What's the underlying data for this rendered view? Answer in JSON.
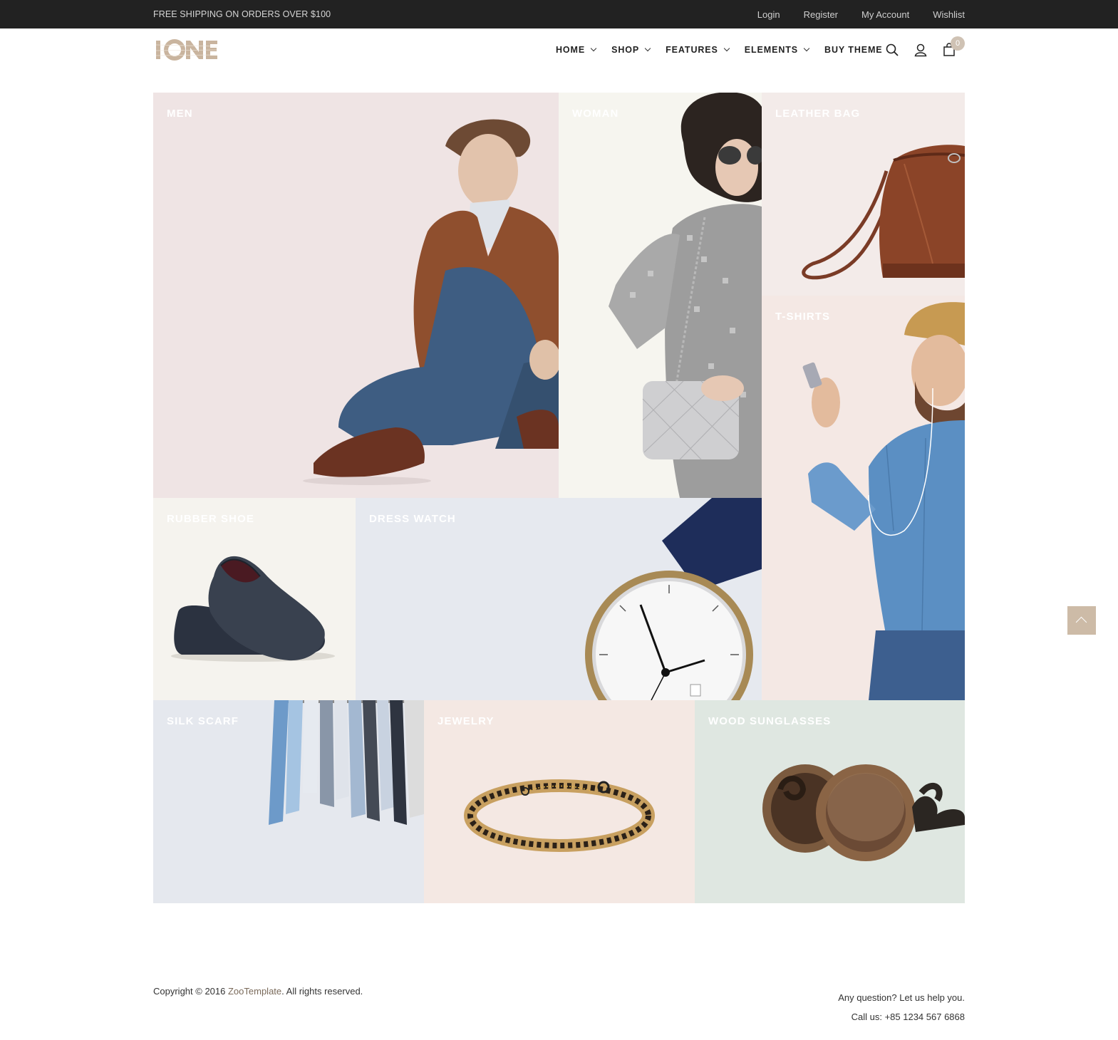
{
  "topbar": {
    "promo": "FREE SHIPPING ON ORDERS OVER $100",
    "links": [
      "Login",
      "Register",
      "My Account",
      "Wishlist"
    ]
  },
  "header": {
    "logo_text": "IONE",
    "nav": [
      "HOME",
      "SHOP",
      "FEATURES",
      "ELEMENTS",
      "BUY THEME"
    ],
    "cart_count": "0",
    "icons": [
      "search-icon",
      "user-icon",
      "cart-icon"
    ]
  },
  "tiles": {
    "men": "MEN",
    "woman": "WOMAN",
    "leather_bag": "LEATHER BAG",
    "tshirts": "T-SHIRTS",
    "rubber_shoe": "RUBBER SHOE",
    "dress_watch": "DRESS WATCH",
    "silk_scarf": "SILK SCARF",
    "jewelry": "JEWELRY",
    "wood_sunglasses": "WOOD SUNGLASSES"
  },
  "footer": {
    "copyright_prefix": "Copyright © 2016 ",
    "copyright_link": "ZooTemplate",
    "copyright_suffix": ". All rights reserved.",
    "question": "Any question? Let us help you.",
    "call": "Call us: +85 1234 567 6868"
  },
  "colors": {
    "topbar_bg": "#222222",
    "accent": "#cdbba7",
    "tile_men": "#efe4e4",
    "tile_woman": "#f6f5ef",
    "tile_bag": "#f3ebe9",
    "tile_tshirts": "#f4e8e4",
    "tile_shoe": "#f5f3ee",
    "tile_watch": "#e6e9ef",
    "tile_scarf": "#e5e8ee",
    "tile_jewelry": "#f4e8e3",
    "tile_sunglasses": "#dfe7e1"
  }
}
